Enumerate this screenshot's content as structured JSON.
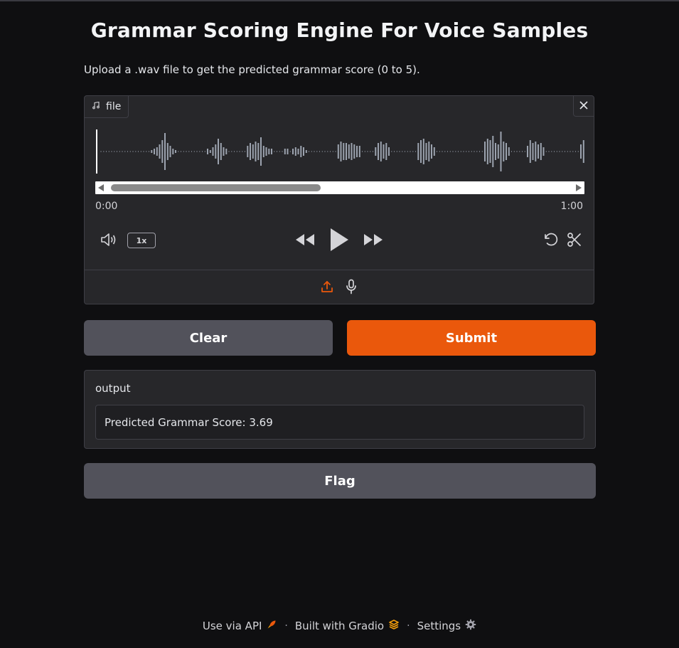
{
  "header": {
    "title": "Grammar Scoring Engine For Voice Samples",
    "description": "Upload a .wav file to get the predicted grammar score (0 to 5)."
  },
  "audio": {
    "label": "file",
    "time_start": "0:00",
    "time_end": "1:00",
    "speed": "1x",
    "scroll_position": 0.2,
    "icons": {
      "label": "music-note-icon",
      "close": "close-icon",
      "volume": "volume-icon",
      "rewind": "rewind-icon",
      "play": "play-icon",
      "forward": "fast-forward-icon",
      "reset": "undo-icon",
      "trim": "scissors-icon",
      "upload": "upload-icon",
      "microphone": "microphone-icon"
    }
  },
  "actions": {
    "clear": "Clear",
    "submit": "Submit",
    "flag": "Flag"
  },
  "output": {
    "label": "output",
    "value": "Predicted Grammar Score: 3.69"
  },
  "footer": {
    "api": "Use via API",
    "built": "Built with Gradio",
    "settings": "Settings"
  },
  "colors": {
    "background": "#0f0f11",
    "panel": "#27272a",
    "accent": "#ea580c",
    "secondary_button": "#52525b",
    "waveform": "#9ca3af"
  }
}
